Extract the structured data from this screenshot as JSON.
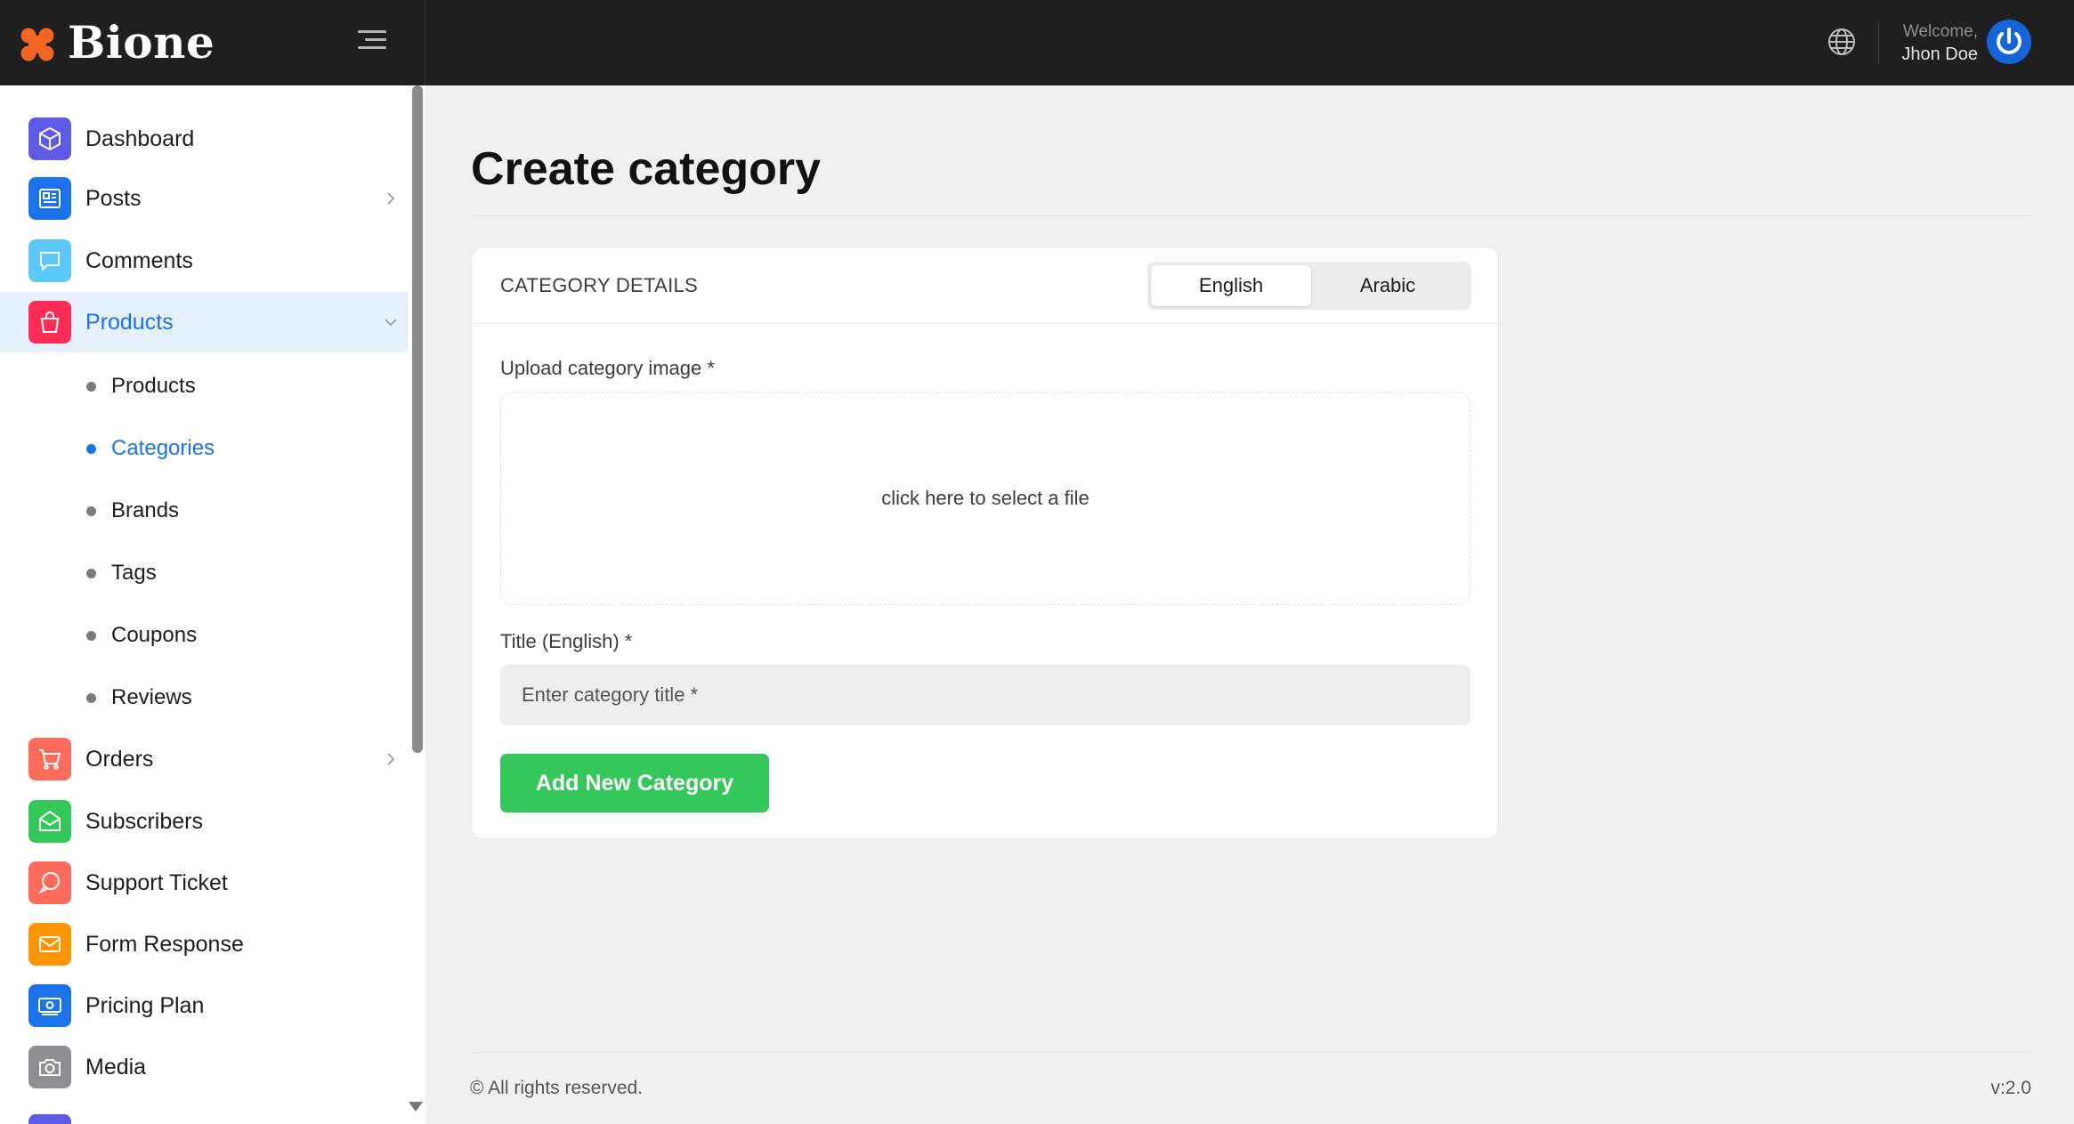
{
  "brand": {
    "name": "Bione",
    "accent": "#f26522"
  },
  "header": {
    "welcome": "Welcome,",
    "user_name": "Jhon Doe",
    "icons": [
      "menu-toggle-icon",
      "globe-icon",
      "power-icon"
    ]
  },
  "sidebar": {
    "items": [
      {
        "label": "Dashboard",
        "icon": "cube-icon",
        "color": "#5e5ce6"
      },
      {
        "label": "Posts",
        "icon": "newspaper-icon",
        "color": "#1a73e8",
        "has_children": true
      },
      {
        "label": "Comments",
        "icon": "chat-bubble-icon",
        "color": "#5ac8fa"
      },
      {
        "label": "Products",
        "icon": "shopping-bag-icon",
        "color": "#ff2d55",
        "active": true,
        "expanded": true
      },
      {
        "label": "Orders",
        "icon": "cart-icon",
        "color": "#ff6b5b",
        "has_children": true
      },
      {
        "label": "Subscribers",
        "icon": "mail-open-icon",
        "color": "#34c759"
      },
      {
        "label": "Support Ticket",
        "icon": "support-chat-icon",
        "color": "#ff6b5b"
      },
      {
        "label": "Form Response",
        "icon": "envelope-icon",
        "color": "#ff9500"
      },
      {
        "label": "Pricing Plan",
        "icon": "money-icon",
        "color": "#1a73e8"
      },
      {
        "label": "Media",
        "icon": "camera-icon",
        "color": "#8e8e93"
      }
    ],
    "products_children": [
      {
        "label": "Products"
      },
      {
        "label": "Categories",
        "active": true
      },
      {
        "label": "Brands"
      },
      {
        "label": "Tags"
      },
      {
        "label": "Coupons"
      },
      {
        "label": "Reviews"
      }
    ]
  },
  "main": {
    "page_title": "Create category",
    "card": {
      "header_title": "CATEGORY DETAILS",
      "tabs": [
        {
          "label": "English",
          "active": true
        },
        {
          "label": "Arabic",
          "active": false
        }
      ],
      "upload_label": "Upload category image *",
      "dropzone_text": "click here to select a file",
      "title_label": "Title (English) *",
      "title_placeholder": "Enter category title *",
      "title_value": "",
      "submit_label": "Add New Category",
      "submit_color": "#34c759"
    }
  },
  "footer": {
    "copyright": "© All rights reserved.",
    "version": "v:2.0"
  }
}
